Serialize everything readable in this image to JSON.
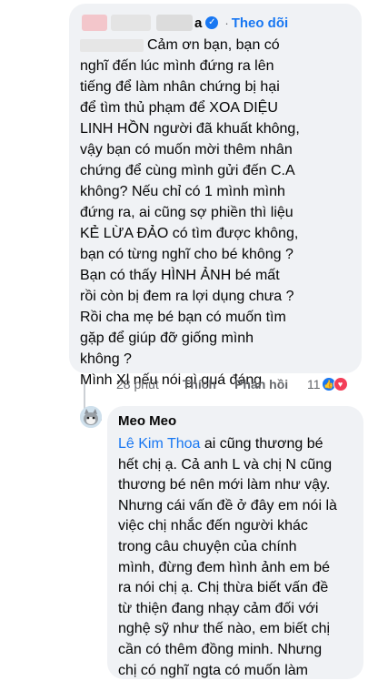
{
  "comment1": {
    "author_suffix": "a",
    "follow_label": "Theo dõi",
    "text": "Cảm ơn bạn, bạn có\nnghĩ đến lúc mình đứng ra lên\ntiếng để làm nhân chứng bị hại\nđể tìm thủ phạm để XOA DIỆU\nLINH HỒN người đã khuất không,\nvậy bạn có muốn mời thêm nhân\nchứng để cùng mình gửi đến C.A\nkhông? Nếu chỉ có 1 mình mình\nđứng ra, ai cũng sợ phiền thì liệu\nKẺ LỪA ĐẢO có tìm được không,\nbạn có từng nghĩ cho bé không ?\nBạn có thấy HÌNH ẢNH bé mất\nrồi còn bị đem ra lợi dụng chưa ?\nRồi cha mẹ bé bạn có muốn tìm\ngặp để giúp đỡ giống mình\nkhông ?\nMình Xl nếu nói gì quá đáng.",
    "time": "28 phút",
    "like_label": "Thích",
    "reply_label": "Phản hồi",
    "reaction_count": "11"
  },
  "comment2": {
    "author": "Meo Meo",
    "mention": "Lê Kim Thoa",
    "text_after_mention": " ai cũng thương bé\nhết chị ạ. Cả anh L và chị N cũng\nthương bé nên mới làm như vậy.\nNhưng cái vấn đề ở đây em nói là\nviệc chị nhắc đến người khác\ntrong câu chuyện của chính\nmình, đừng đem hình ảnh em bé\nra nói chị ạ. Chị thừa biết vấn đề\ntừ thiện đang nhạy cảm đối với\nnghệ sỹ như thế nào, em biết chị\ncần có thêm đồng minh. Nhưng\nchị có nghĩ ngta có muốn làm"
  },
  "icons": {
    "verified": "verified-check-icon",
    "like": "like-reaction-icon",
    "love": "love-reaction-icon",
    "avatar": "cat-avatar"
  },
  "colors": {
    "bubble": "#f0f2f5",
    "link": "#1877f2",
    "meta": "#65676b"
  }
}
